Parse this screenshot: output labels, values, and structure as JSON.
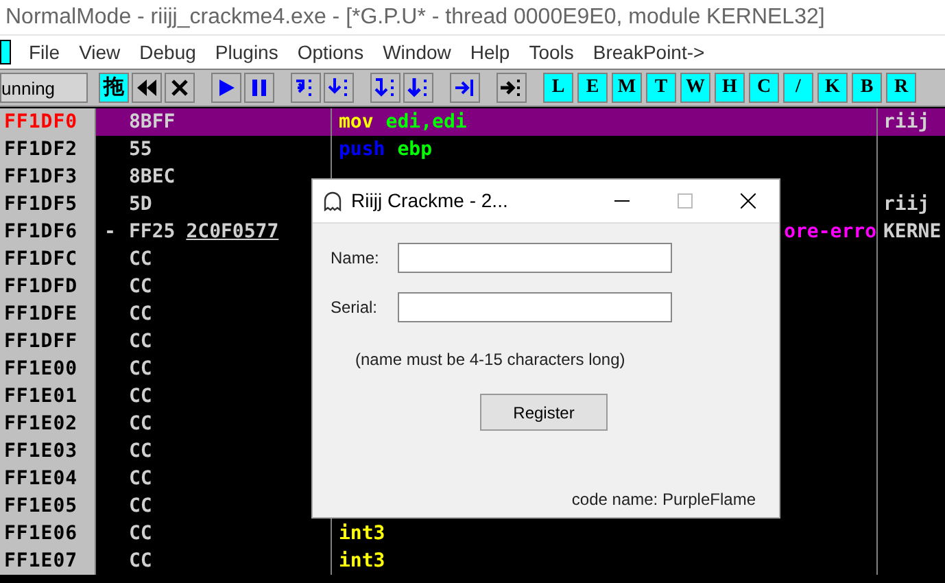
{
  "window": {
    "title": "NormalMode - riijj_crackme4.exe - [*G.P.U* - thread 0000E9E0, module KERNEL32]"
  },
  "menu": [
    "File",
    "View",
    "Debug",
    "Plugins",
    "Options",
    "Window",
    "Help",
    "Tools",
    "BreakPoint->"
  ],
  "status": "unning",
  "toolbar": [
    {
      "kind": "text",
      "label": "拖"
    },
    {
      "kind": "rewind"
    },
    {
      "kind": "close"
    },
    {
      "kind": "gap"
    },
    {
      "kind": "play"
    },
    {
      "kind": "pause"
    },
    {
      "kind": "gap"
    },
    {
      "kind": "step-into"
    },
    {
      "kind": "step-over"
    },
    {
      "kind": "gap"
    },
    {
      "kind": "trace-into"
    },
    {
      "kind": "trace-over"
    },
    {
      "kind": "gap"
    },
    {
      "kind": "till-return"
    },
    {
      "kind": "gap"
    },
    {
      "kind": "goto"
    },
    {
      "kind": "gap"
    },
    {
      "kind": "letter",
      "label": "L"
    },
    {
      "kind": "letter",
      "label": "E"
    },
    {
      "kind": "letter",
      "label": "M"
    },
    {
      "kind": "letter",
      "label": "T"
    },
    {
      "kind": "letter",
      "label": "W"
    },
    {
      "kind": "letter",
      "label": "H"
    },
    {
      "kind": "letter",
      "label": "C"
    },
    {
      "kind": "letter",
      "label": "/"
    },
    {
      "kind": "letter",
      "label": "K"
    },
    {
      "kind": "letter",
      "label": "B"
    },
    {
      "kind": "letter",
      "label": "R"
    }
  ],
  "rows": [
    {
      "address": "FF1DF0",
      "hex": "8BFF",
      "selected": true,
      "op": "mov",
      "args": "edi,edi",
      "comment": "riij"
    },
    {
      "address": "FF1DF2",
      "hex": "55",
      "selected": false,
      "op": "push",
      "args": "ebp"
    },
    {
      "address": "FF1DF3",
      "hex": "8BEC",
      "selected": false
    },
    {
      "address": "FF1DF5",
      "hex": "5D",
      "selected": false,
      "comment": "riij"
    },
    {
      "address": "FF1DF6",
      "marker": "-",
      "hex": "FF25",
      "operand": "2C0F0577",
      "selected": false,
      "tail": "ore-erro",
      "comment": "KERNE"
    },
    {
      "address": "FF1DFC",
      "hex": "CC",
      "selected": false
    },
    {
      "address": "FF1DFD",
      "hex": "CC",
      "selected": false
    },
    {
      "address": "FF1DFE",
      "hex": "CC",
      "selected": false
    },
    {
      "address": "FF1DFF",
      "hex": "CC",
      "selected": false
    },
    {
      "address": "FF1E00",
      "hex": "CC",
      "selected": false
    },
    {
      "address": "FF1E01",
      "hex": "CC",
      "selected": false
    },
    {
      "address": "FF1E02",
      "hex": "CC",
      "selected": false
    },
    {
      "address": "FF1E03",
      "hex": "CC",
      "selected": false
    },
    {
      "address": "FF1E04",
      "hex": "CC",
      "selected": false
    },
    {
      "address": "FF1E05",
      "hex": "CC",
      "selected": false
    },
    {
      "address": "FF1E06",
      "hex": "CC",
      "selected": false,
      "op": "int3"
    },
    {
      "address": "FF1E07",
      "hex": "CC",
      "selected": false,
      "op": "int3"
    }
  ],
  "dialog": {
    "title": "Riijj Crackme - 2...",
    "name_label": "Name:",
    "serial_label": "Serial:",
    "hint": "(name must be 4-15 characters long)",
    "button": "Register",
    "footer": "code name: PurpleFlame"
  }
}
